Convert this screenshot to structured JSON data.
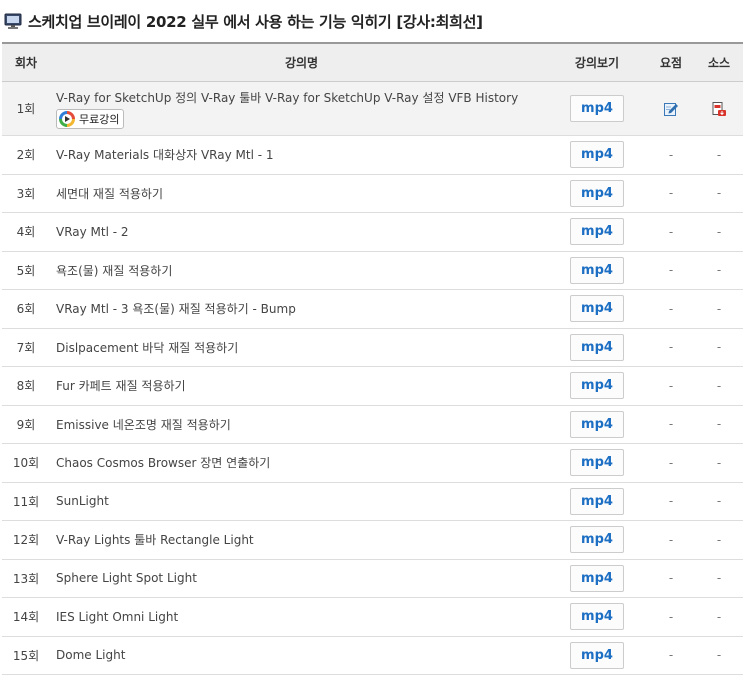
{
  "header": {
    "title": "스케치업 브이레이 2022 실무 에서 사용 하는 기능 익히기 [강사:최희선]",
    "icon": "monitor-icon"
  },
  "table": {
    "columns": {
      "no": "회차",
      "title": "강의명",
      "view": "강의보기",
      "summary": "요점",
      "source": "소스"
    },
    "free_badge_label": "무료강의",
    "view_label": "mp4",
    "rows": [
      {
        "no": "1회",
        "title": "V-Ray for SketchUp 정의 V-Ray 툴바 V-Ray for SketchUp V-Ray 설정 VFB History",
        "summary": "edit-icon",
        "source": "download-icon"
      },
      {
        "no": "2회",
        "title": "V-Ray Materials 대화상자 VRay Mtl - 1",
        "summary": "-",
        "source": "-"
      },
      {
        "no": "3회",
        "title": "세면대 재질 적용하기",
        "summary": "-",
        "source": "-"
      },
      {
        "no": "4회",
        "title": "VRay Mtl - 2",
        "summary": "-",
        "source": "-"
      },
      {
        "no": "5회",
        "title": "욕조(물) 재질 적용하기",
        "summary": "-",
        "source": "-"
      },
      {
        "no": "6회",
        "title": "VRay Mtl - 3 욕조(물) 재질 적용하기 - Bump",
        "summary": "-",
        "source": "-"
      },
      {
        "no": "7회",
        "title": "Dislpacement 바닥 재질 적용하기",
        "summary": "-",
        "source": "-"
      },
      {
        "no": "8회",
        "title": "Fur 카페트 재질 적용하기",
        "summary": "-",
        "source": "-"
      },
      {
        "no": "9회",
        "title": "Emissive 네온조명 재질 적용하기",
        "summary": "-",
        "source": "-"
      },
      {
        "no": "10회",
        "title": "Chaos Cosmos Browser 장면 연출하기",
        "summary": "-",
        "source": "-"
      },
      {
        "no": "11회",
        "title": "SunLight",
        "summary": "-",
        "source": "-"
      },
      {
        "no": "12회",
        "title": "V-Ray Lights 툴바 Rectangle Light",
        "summary": "-",
        "source": "-"
      },
      {
        "no": "13회",
        "title": "Sphere Light Spot Light",
        "summary": "-",
        "source": "-"
      },
      {
        "no": "14회",
        "title": "IES Light Omni Light",
        "summary": "-",
        "source": "-"
      },
      {
        "no": "15회",
        "title": "Dome Light",
        "summary": "-",
        "source": "-"
      }
    ]
  },
  "colors": {
    "accent": "#1d6fc4",
    "header_bg": "#eeeeee",
    "first_row_bg": "#f3f3f3"
  }
}
